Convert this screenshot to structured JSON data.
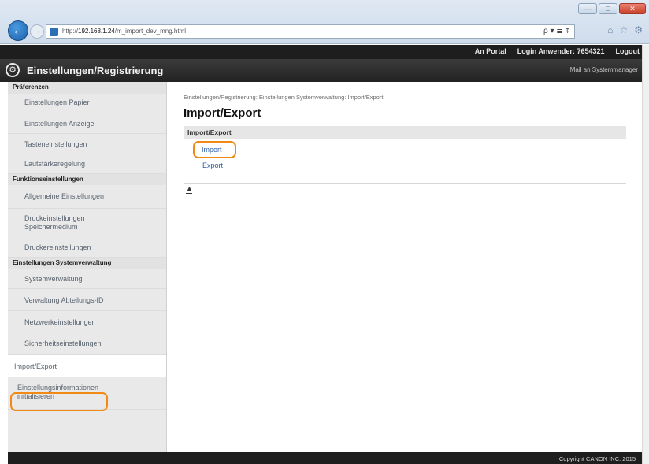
{
  "browser": {
    "url_prefix": "http://",
    "url_host": "192.168.1.24",
    "url_path": "/m_import_dev_mng.html",
    "address_tools": "ρ ▾ ≣ ¢",
    "window_buttons": [
      "—",
      "□",
      "✕"
    ],
    "toolbar_icons": [
      "⌂",
      "☆",
      "⚙"
    ]
  },
  "topbar": {
    "device_name": "",
    "portal_link": "An Portal",
    "login_label": "Login Anwender:",
    "login_user": "7654321",
    "logout_link": "Logout"
  },
  "header": {
    "title": "Einstellungen/Registrierung",
    "mail_link": "Mail an Systemmanager"
  },
  "sidebar": {
    "sections": [
      {
        "label": "Präferenzen",
        "items": [
          "Einstellungen Papier",
          "Einstellungen Anzeige",
          "Tasteneinstellungen",
          "Lautstärkeregelung"
        ]
      },
      {
        "label": "Funktionseinstellungen",
        "items": [
          "Allgemeine Einstellungen",
          "Druckeinstellungen Speichermedium",
          "Druckereinstellungen"
        ]
      },
      {
        "label": "Einstellungen Systemverwaltung",
        "items": [
          "Systemverwaltung",
          "Verwaltung Abteilungs-ID",
          "Netzwerkeinstellungen",
          "Sicherheitseinstellungen",
          "Import/Export",
          "Einstellungsinformationen initialisieren"
        ]
      }
    ]
  },
  "main": {
    "breadcrumb": "Einstellungen/Registrierung: Einstellungen Systemverwaltung: Import/Export",
    "page_title": "Import/Export",
    "section_title": "Import/Export",
    "links": [
      "Import",
      "Export"
    ],
    "top_icon": "▲"
  },
  "footer": {
    "copyright": "Copyright CANON INC. 2015"
  },
  "colors": {
    "highlight": "#f08a14",
    "link": "#2a5ea8",
    "header_bg": "#2a2a2a"
  }
}
